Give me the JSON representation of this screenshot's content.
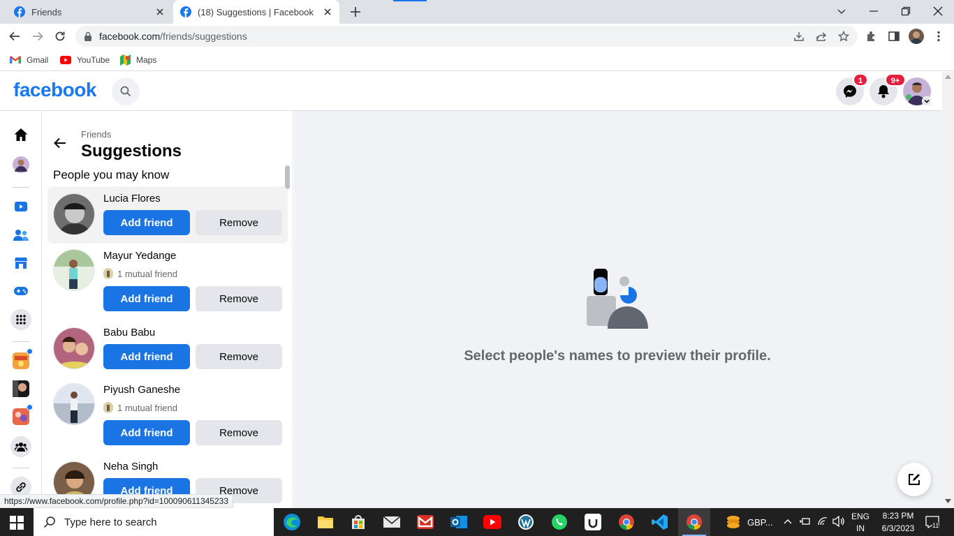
{
  "browser": {
    "tabs": [
      {
        "title": "Friends",
        "icon": "facebook-icon"
      },
      {
        "title": "(18) Suggestions | Facebook",
        "icon": "facebook-icon",
        "active": true
      }
    ],
    "url_host": "facebook.com",
    "url_path": "/friends/suggestions",
    "bookmarks": [
      {
        "label": "Gmail",
        "icon": "gmail-icon"
      },
      {
        "label": "YouTube",
        "icon": "youtube-icon"
      },
      {
        "label": "Maps",
        "icon": "maps-icon"
      }
    ],
    "status_url": "https://www.facebook.com/profile.php?id=100090611345233"
  },
  "fb": {
    "logo": "facebook",
    "messenger_badge": "1",
    "notifications_badge": "9+",
    "colors": {
      "brand": "#1877f2",
      "badge": "#e41e3f",
      "button": "#1b74e4"
    }
  },
  "panel": {
    "breadcrumb": "Friends",
    "title": "Suggestions",
    "subheading": "People you may know",
    "add_label": "Add friend",
    "remove_label": "Remove",
    "people": [
      {
        "name": "Lucia Flores",
        "mutual": ""
      },
      {
        "name": "Mayur Yedange",
        "mutual": "1 mutual friend"
      },
      {
        "name": "Babu Babu",
        "mutual": ""
      },
      {
        "name": "Piyush Ganeshe",
        "mutual": "1 mutual friend"
      },
      {
        "name": "Neha Singh",
        "mutual": ""
      }
    ]
  },
  "main": {
    "empty_text": "Select people's names to preview their profile."
  },
  "taskbar": {
    "search_placeholder": "Type here to search",
    "tray_label": "GBP...",
    "lang_top": "ENG",
    "lang_bottom": "IN",
    "time": "8:23 PM",
    "date": "6/3/2023",
    "notif_count": "11"
  }
}
